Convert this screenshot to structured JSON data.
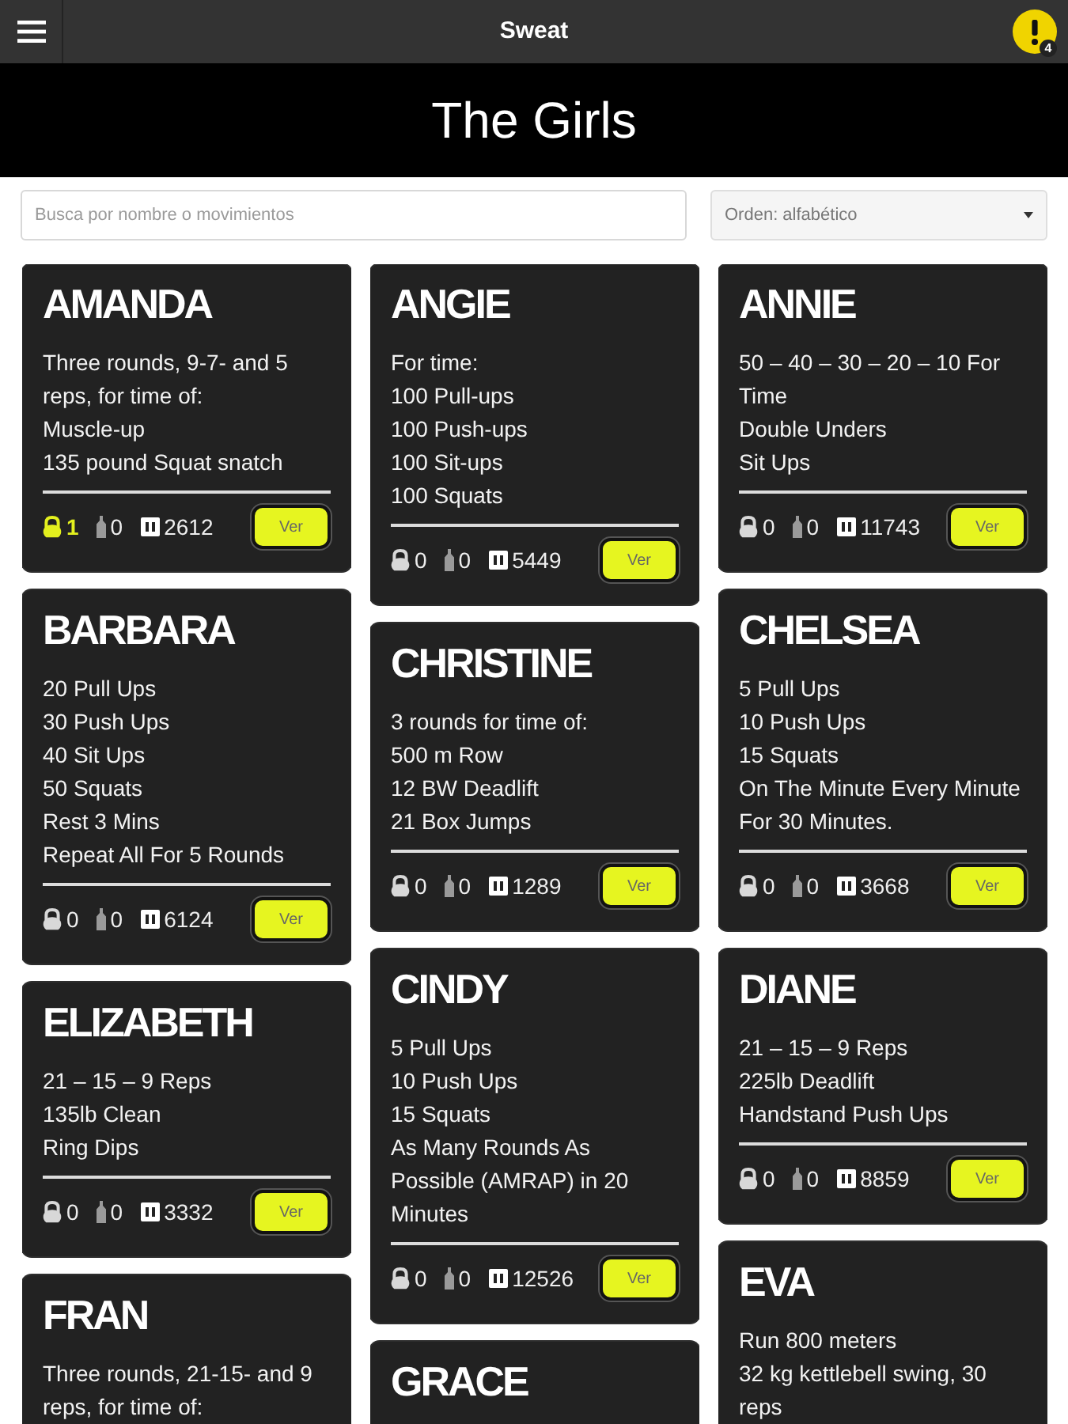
{
  "top_bar": {
    "title": "Sweat",
    "notification_count": "4"
  },
  "header": {
    "title": "The Girls"
  },
  "search": {
    "placeholder": "Busca por nombre o movimientos"
  },
  "sort": {
    "value": "Orden: alfabético"
  },
  "columns": [
    [
      {
        "name": "AMANDA",
        "lines": [
          "Three rounds, 9-7- and 5 reps, for time of:",
          "Muscle-up",
          "135 pound Squat snatch"
        ],
        "highlighted": true,
        "stats": [
          "1",
          "0",
          "2612"
        ],
        "button": "Ver"
      },
      {
        "name": "BARBARA",
        "lines": [
          "20 Pull Ups",
          "30 Push Ups",
          "40 Sit Ups",
          "50 Squats",
          "Rest 3 Mins",
          "Repeat All For 5 Rounds"
        ],
        "highlighted": false,
        "stats": [
          "0",
          "0",
          "6124"
        ],
        "button": "Ver"
      },
      {
        "name": "ELIZABETH",
        "lines": [
          "21 – 15 – 9 Reps",
          "135lb Clean",
          "Ring Dips"
        ],
        "highlighted": false,
        "stats": [
          "0",
          "0",
          "3332"
        ],
        "button": "Ver"
      },
      {
        "name": "FRAN",
        "lines": [
          "Three rounds, 21-15- and 9 reps, for time of:"
        ]
      }
    ],
    [
      {
        "name": "ANGIE",
        "lines": [
          "For time:",
          "100 Pull-ups",
          "100 Push-ups",
          "100 Sit-ups",
          "100 Squats"
        ],
        "highlighted": false,
        "stats": [
          "0",
          "0",
          "5449"
        ],
        "button": "Ver"
      },
      {
        "name": "CHRISTINE",
        "lines": [
          "3 rounds for time of:",
          "500 m Row",
          "12 BW Deadlift",
          "21 Box Jumps"
        ],
        "highlighted": false,
        "stats": [
          "0",
          "0",
          "1289"
        ],
        "button": "Ver"
      },
      {
        "name": "CINDY",
        "lines": [
          "5 Pull Ups",
          "10 Push Ups",
          "15 Squats",
          "As Many Rounds As Possible (AMRAP) in 20 Minutes"
        ],
        "highlighted": false,
        "stats": [
          "0",
          "0",
          "12526"
        ],
        "button": "Ver"
      },
      {
        "name": "GRACE"
      }
    ],
    [
      {
        "name": "ANNIE",
        "lines": [
          "50 – 40 – 30 – 20 – 10 For Time",
          "Double Unders",
          "Sit Ups"
        ],
        "highlighted": false,
        "stats": [
          "0",
          "0",
          "11743"
        ],
        "button": "Ver"
      },
      {
        "name": "CHELSEA",
        "lines": [
          "5 Pull Ups",
          "10 Push Ups",
          "15 Squats",
          "On The Minute Every Minute For 30 Minutes."
        ],
        "highlighted": false,
        "stats": [
          "0",
          "0",
          "3668"
        ],
        "button": "Ver"
      },
      {
        "name": "DIANE",
        "lines": [
          "21 – 15 – 9 Reps",
          "225lb Deadlift",
          "Handstand Push Ups"
        ],
        "highlighted": false,
        "stats": [
          "0",
          "0",
          "8859"
        ],
        "button": "Ver"
      },
      {
        "name": "EVA",
        "lines": [
          "Run 800 meters",
          "32 kg kettlebell swing, 30 reps"
        ]
      }
    ]
  ]
}
